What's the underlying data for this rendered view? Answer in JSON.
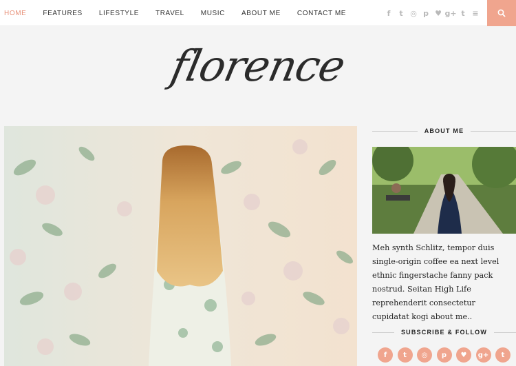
{
  "nav": {
    "items": [
      {
        "label": "HOME",
        "active": true
      },
      {
        "label": "FEATURES",
        "active": false
      },
      {
        "label": "LIFESTYLE",
        "active": false
      },
      {
        "label": "TRAVEL",
        "active": false
      },
      {
        "label": "MUSIC",
        "active": false
      },
      {
        "label": "ABOUT ME",
        "active": false
      },
      {
        "label": "CONTACT ME",
        "active": false
      }
    ],
    "social_icons": [
      "facebook-icon",
      "twitter-icon",
      "instagram-icon",
      "pinterest-icon",
      "heart-icon",
      "google-plus-icon",
      "tumblr-icon",
      "rss-icon"
    ],
    "social_glyphs": [
      "f",
      "t",
      "◎",
      "p",
      "♥",
      "g+",
      "t",
      "≡"
    ]
  },
  "brand": {
    "logo_text": "florence"
  },
  "sidebar": {
    "about_title": "ABOUT ME",
    "about_text": "Meh synth Schlitz, tempor duis single-origin coffee ea next level ethnic fingerstache fanny pack nostrud. Seitan High Life reprehenderit consectetur cupidatat kogi about me..",
    "follow_title": "SUBSCRIBE & FOLLOW",
    "follow_icons": [
      "facebook-icon",
      "twitter-icon",
      "instagram-icon",
      "pinterest-icon",
      "heart-icon",
      "google-plus-icon",
      "tumblr-icon"
    ],
    "follow_glyphs": [
      "f",
      "t",
      "◎",
      "p",
      "♥",
      "g+",
      "t"
    ]
  },
  "colors": {
    "accent": "#f0a58e",
    "active_nav": "#e8937b",
    "background": "#f4f4f4"
  }
}
